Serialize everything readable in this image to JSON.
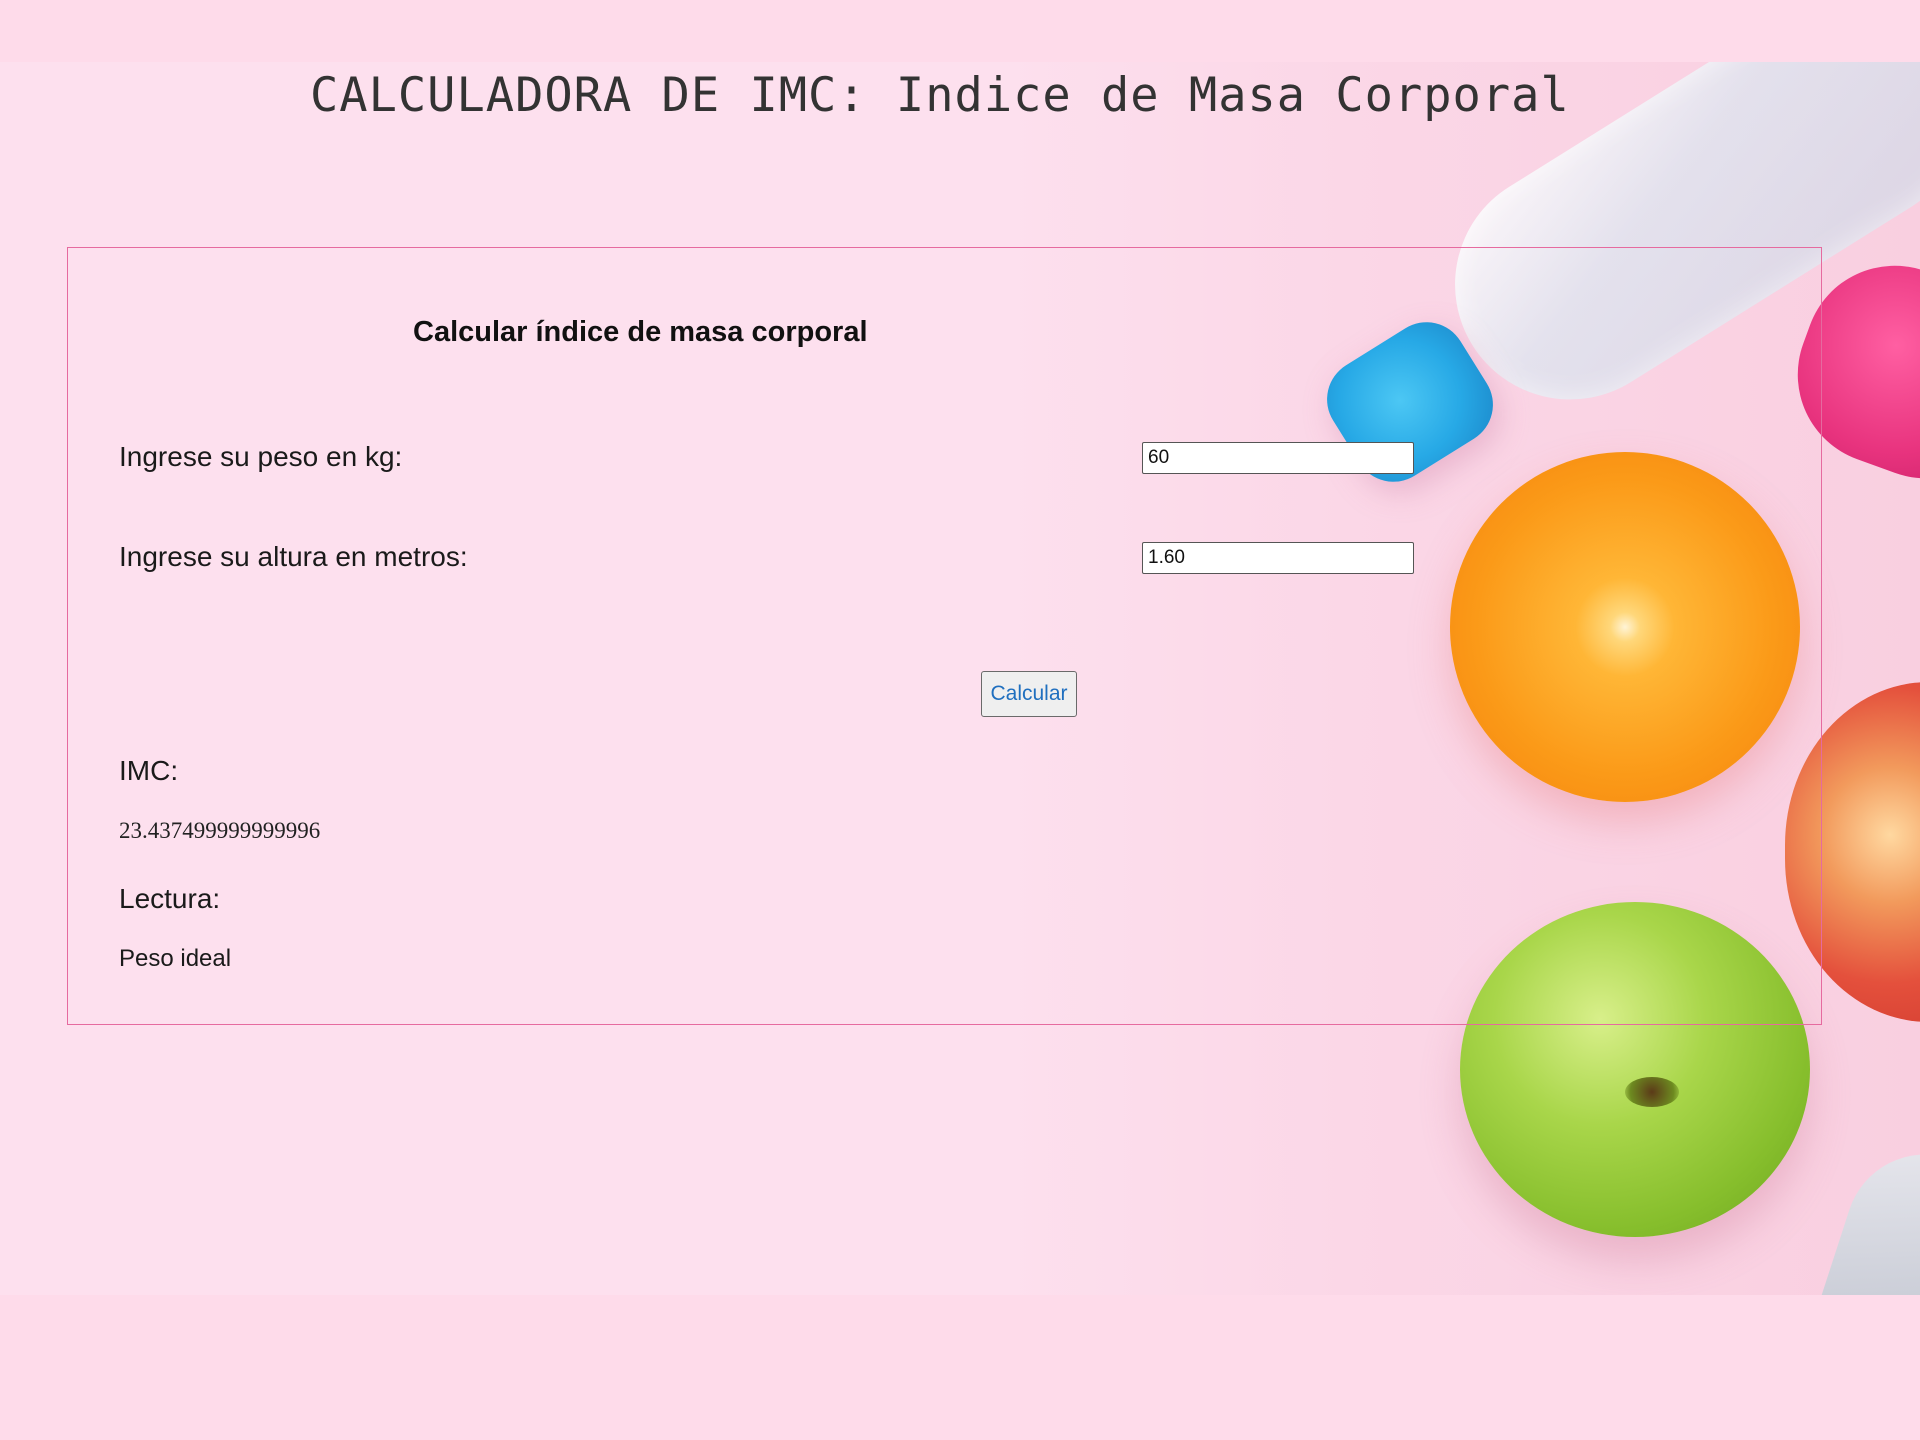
{
  "header": {
    "title": "CALCULADORA DE IMC: Indice de Masa Corporal"
  },
  "form": {
    "heading": "Calcular índice de masa corporal",
    "weight_label": "Ingrese su peso en kg:",
    "weight_value": "60",
    "height_label": "Ingrese su altura en metros:",
    "height_value": "1.60",
    "calculate_label": "Calcular"
  },
  "result": {
    "imc_label": "IMC:",
    "imc_value": "23.437499999999996",
    "lectura_label": "Lectura:",
    "lectura_value": "Peso ideal"
  },
  "colors": {
    "background": "#fedbea",
    "panel_border": "#e66a9f",
    "button_text": "#1f6fbf"
  },
  "icons": [
    "water-bottle-image",
    "orange-image",
    "red-apple-image",
    "green-apple-image",
    "pink-dumbbell-image",
    "sneaker-image"
  ]
}
